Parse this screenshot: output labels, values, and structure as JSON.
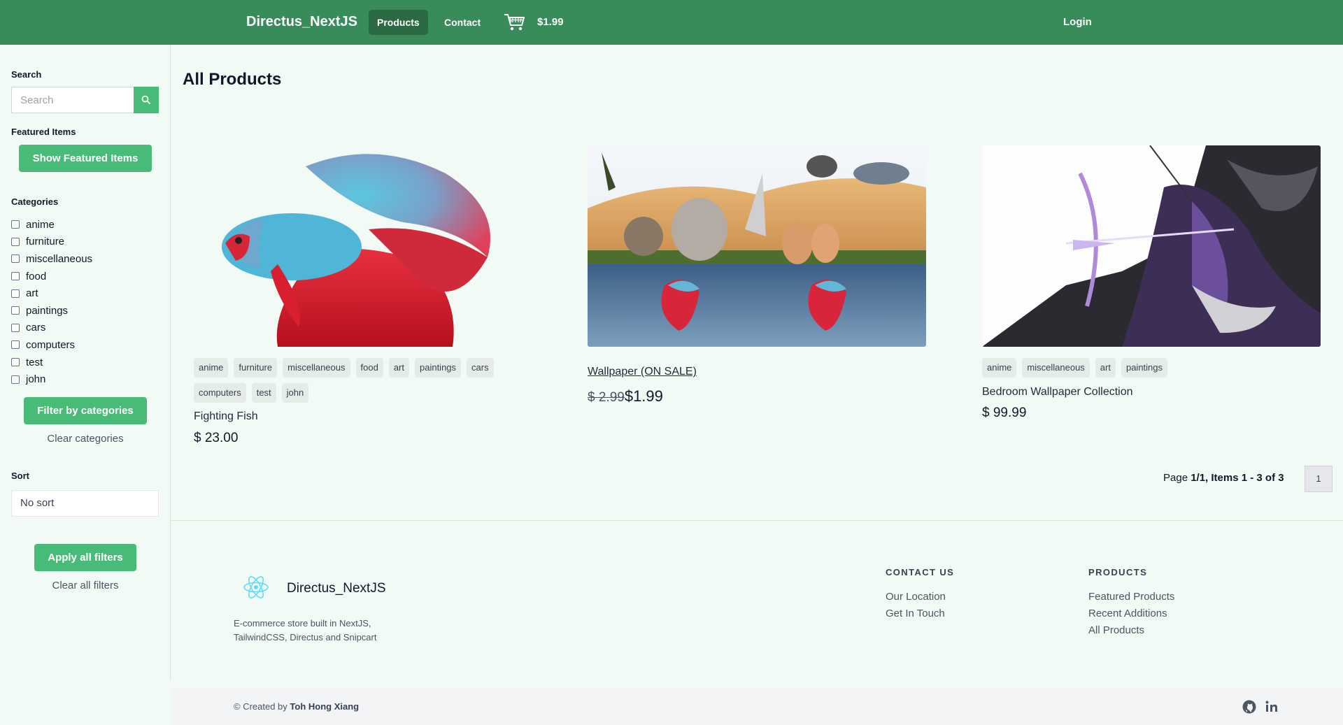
{
  "nav": {
    "brand": "Directus_NextJS",
    "products": "Products",
    "contact": "Contact",
    "cart_total": "$1.99",
    "login": "Login",
    "bg_color": "#378c59"
  },
  "sidebar": {
    "search_label": "Search",
    "search_placeholder": "Search",
    "featured_label": "Featured Items",
    "featured_button": "Show Featured Items",
    "categories_label": "Categories",
    "categories": [
      "anime",
      "furniture",
      "miscellaneous",
      "food",
      "art",
      "paintings",
      "cars",
      "computers",
      "test",
      "john"
    ],
    "filter_button": "Filter by categories",
    "clear_categories": "Clear categories",
    "sort_label": "Sort",
    "sort_value": "No sort",
    "apply_button": "Apply all filters",
    "clear_all": "Clear all filters"
  },
  "main": {
    "title": "All Products",
    "products": [
      {
        "tags": [
          "anime",
          "furniture",
          "miscellaneous",
          "food",
          "art",
          "paintings",
          "cars",
          "computers",
          "test",
          "john"
        ],
        "name": "Fighting Fish",
        "price": "$ 23.00"
      },
      {
        "name": "Wallpaper (ON SALE)",
        "old_price": "$ 2.99",
        "price": "$1.99"
      },
      {
        "tags": [
          "anime",
          "miscellaneous",
          "art",
          "paintings"
        ],
        "name": "Bedroom Wallpaper Collection",
        "price": "$ 99.99"
      }
    ],
    "pager": {
      "prefix": "Page ",
      "summary": "1/1, Items 1 - 3 of 3",
      "page": "1"
    }
  },
  "footer": {
    "brand": "Directus_NextJS",
    "description": "E-commerce store built in NextJS, TailwindCSS, Directus and Snipcart",
    "contact_heading": "CONTACT US",
    "contact_links": [
      "Our Location",
      "Get In Touch"
    ],
    "products_heading": "PRODUCTS",
    "products_links": [
      "Featured Products",
      "Recent Additions",
      "All Products"
    ],
    "credit_prefix": "© Created by ",
    "credit_name": "Toh Hong Xiang"
  },
  "colors": {
    "accent": "#48bb78",
    "page_bg": "#f2faf5"
  },
  "icons": [
    "cart-icon",
    "search-icon",
    "react-logo-icon",
    "github-icon",
    "linkedin-icon"
  ]
}
